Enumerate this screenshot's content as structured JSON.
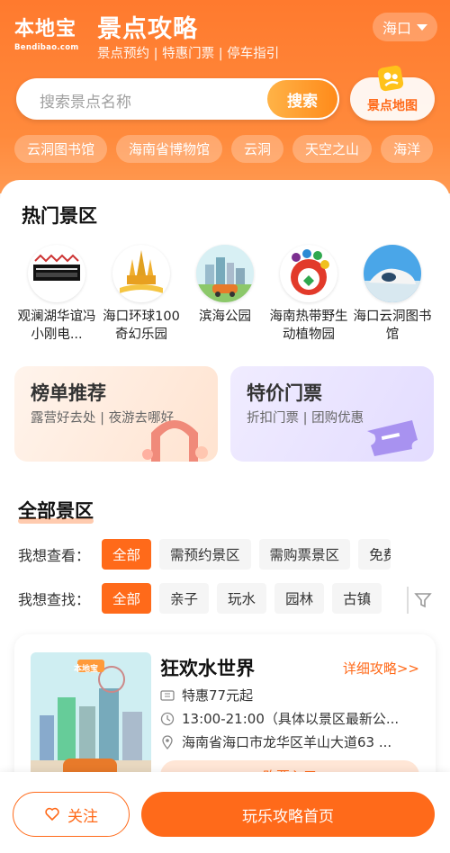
{
  "header": {
    "logo_cn": "本地宝",
    "logo_en": "Bendibao.com",
    "title": "景点攻略",
    "subtitle": "景点预约 | 特惠门票 | 停车指引",
    "city": "海口"
  },
  "search": {
    "placeholder": "搜索景点名称",
    "button": "搜索",
    "map_button": "景点地图"
  },
  "quick_chips": [
    "云洞图书馆",
    "海南省博物馆",
    "云洞",
    "天空之山",
    "海洋"
  ],
  "hot_section": {
    "title": "热门景区",
    "items": [
      {
        "name": "观澜湖华谊冯小刚电...",
        "icon": "guanlan-lake-logo"
      },
      {
        "name": "海口环球100奇幻乐园",
        "icon": "castle-park-logo"
      },
      {
        "name": "滨海公园",
        "icon": "city-car-illustration"
      },
      {
        "name": "海南热带野生动植物园",
        "icon": "wildlife-park-logo"
      },
      {
        "name": "海口云洞图书馆",
        "icon": "cloud-cave-library"
      }
    ]
  },
  "promos": [
    {
      "title": "榜单推荐",
      "subtitle": "露营好去处 | 夜游去哪好"
    },
    {
      "title": "特价门票",
      "subtitle": "折扣门票 | 团购优惠"
    }
  ],
  "all_section": {
    "title": "全部景区",
    "filter1": {
      "label": "我想查看：",
      "tags": [
        "全部",
        "需预约景区",
        "需购票景区",
        "免费"
      ]
    },
    "filter2": {
      "label": "我想查找：",
      "tags": [
        "全部",
        "亲子",
        "玩水",
        "园林",
        "古镇"
      ]
    }
  },
  "spot": {
    "name": "狂欢水世界",
    "detail_link": "详细攻略>>",
    "price": "特惠77元起",
    "hours": "13:00-21:00（具体以景区最新公...",
    "address": "海南省海口市龙华区羊山大道63 ...",
    "buy_button": "购票入口",
    "thumb_badge": "本地宝"
  },
  "bottom_bar": {
    "follow": "关注",
    "home": "玩乐攻略首页"
  },
  "colors": {
    "accent": "#ff6a1a",
    "header_top": "#ff7a2e",
    "search_button": "#ff8a1a"
  }
}
